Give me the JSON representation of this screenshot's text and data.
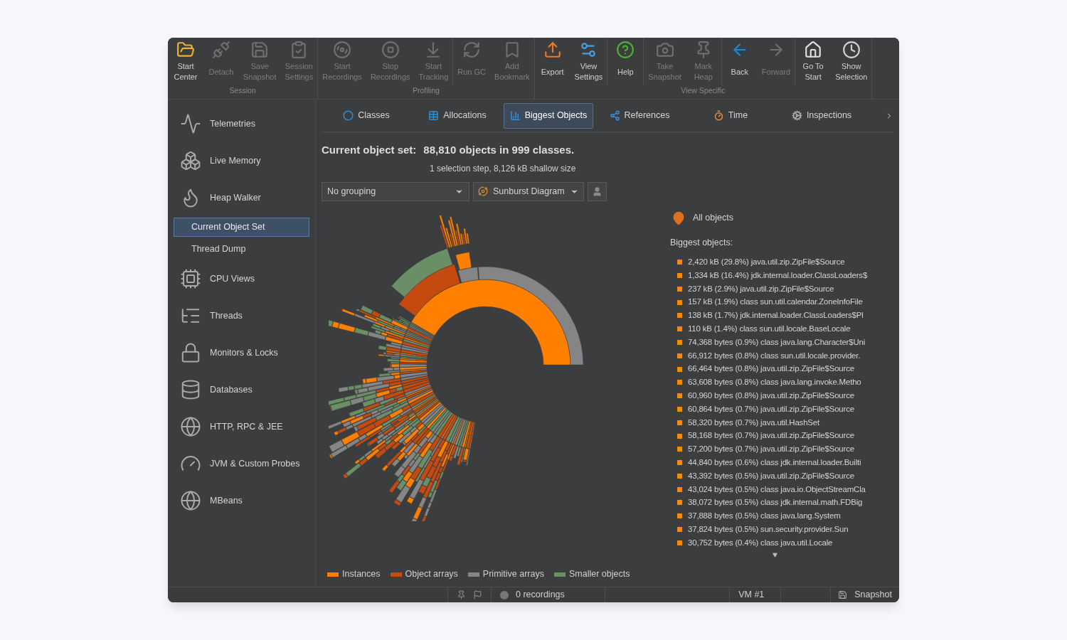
{
  "toolbar": {
    "groups": [
      {
        "label": "Session",
        "sections": [
          [
            {
              "label": "Start\nCenter",
              "disabled": false
            },
            {
              "label": "Detach",
              "disabled": true
            },
            {
              "label": "Save\nSnapshot",
              "disabled": true
            },
            {
              "label": "Session\nSettings",
              "disabled": true
            }
          ]
        ]
      },
      {
        "label": "Profiling",
        "sections": [
          [
            {
              "label": "Start\nRecordings",
              "disabled": true
            },
            {
              "label": "Stop\nRecordings",
              "disabled": true
            },
            {
              "label": "Start\nTracking",
              "disabled": true
            }
          ],
          [
            {
              "label": "Run GC",
              "disabled": true
            },
            {
              "label": "Add\nBookmark",
              "disabled": true
            }
          ]
        ]
      },
      {
        "label": "View Specific",
        "sections": [
          [
            {
              "label": "Export",
              "disabled": false
            },
            {
              "label": "View\nSettings",
              "disabled": false
            }
          ],
          [
            {
              "label": "Help",
              "disabled": false
            }
          ],
          [
            {
              "label": "Take\nSnapshot",
              "disabled": true
            },
            {
              "label": "Mark\nHeap",
              "disabled": true
            }
          ],
          [
            {
              "label": "Back",
              "disabled": false
            },
            {
              "label": "Forward",
              "disabled": true
            }
          ],
          [
            {
              "label": "Go To\nStart",
              "disabled": false
            },
            {
              "label": "Show\nSelection",
              "disabled": false
            }
          ]
        ]
      }
    ]
  },
  "sidebar": {
    "items": [
      {
        "kind": "view",
        "label": "Telemetries",
        "selected": false
      },
      {
        "kind": "view",
        "label": "Live Memory",
        "selected": false
      },
      {
        "kind": "view",
        "label": "Heap Walker",
        "selected": false
      },
      {
        "kind": "sub",
        "label": "Current Object Set",
        "selected": true
      },
      {
        "kind": "sub",
        "label": "Thread Dump",
        "selected": false
      },
      {
        "kind": "view",
        "label": "CPU Views",
        "selected": false
      },
      {
        "kind": "view",
        "label": "Threads",
        "selected": false
      },
      {
        "kind": "view",
        "label": "Monitors & Locks",
        "selected": false
      },
      {
        "kind": "view",
        "label": "Databases",
        "selected": false
      },
      {
        "kind": "view",
        "label": "HTTP, RPC & JEE",
        "selected": false
      },
      {
        "kind": "view",
        "label": "JVM & Custom Probes",
        "selected": false
      },
      {
        "kind": "view",
        "label": "MBeans",
        "selected": false
      }
    ]
  },
  "tabs": [
    {
      "label": "Classes",
      "selected": false
    },
    {
      "label": "Allocations",
      "selected": false
    },
    {
      "label": "Biggest Objects",
      "selected": true
    },
    {
      "label": "References",
      "selected": false
    },
    {
      "label": "Time",
      "selected": false
    },
    {
      "label": "Inspections",
      "selected": false
    }
  ],
  "header": {
    "title": "Current object set:",
    "summary": "88,810 objects in 999 classes.",
    "detail": "1 selection step, 8,126 kB shallow size"
  },
  "controls": {
    "grouping": "No grouping",
    "view": "Sunburst Diagram"
  },
  "details": {
    "root": "All objects",
    "heading": "Biggest objects:",
    "items": [
      "2,420 kB (29.8%) java.util.zip.ZipFile$Source",
      "1,334 kB (16.4%) jdk.internal.loader.ClassLoaders$",
      "237 kB (2.9%) java.util.zip.ZipFile$Source",
      "157 kB (1.9%) class sun.util.calendar.ZoneInfoFile",
      "138 kB (1.7%) jdk.internal.loader.ClassLoaders$Pl",
      "110 kB (1.4%) class sun.util.locale.BaseLocale",
      "74,368 bytes (0.9%) class java.lang.Character$Uni",
      "66,912 bytes (0.8%) class sun.util.locale.provider.",
      "66,464 bytes (0.8%) java.util.zip.ZipFile$Source",
      "63,608 bytes (0.8%) class java.lang.invoke.Metho",
      "60,960 bytes (0.8%) java.util.zip.ZipFile$Source",
      "60,864 bytes (0.7%) java.util.zip.ZipFile$Source",
      "58,320 bytes (0.7%) java.util.HashSet",
      "58,168 bytes (0.7%) java.util.zip.ZipFile$Source",
      "57,200 bytes (0.7%) java.util.zip.ZipFile$Source",
      "44,840 bytes (0.6%) class jdk.internal.loader.Builti",
      "43,392 bytes (0.5%) java.util.zip.ZipFile$Source",
      "43,024 bytes (0.5%) class java.io.ObjectStreamCla",
      "38,072 bytes (0.5%) class jdk.internal.math.FDBig",
      "37,888 bytes (0.5%) class java.lang.System",
      "37,824 bytes (0.5%) sun.security.provider.Sun",
      "30,752 bytes (0.4%) class java.util.Locale"
    ]
  },
  "legend": [
    {
      "label": "Instances",
      "color": "#ff8000"
    },
    {
      "label": "Object arrays",
      "color": "#c44a10"
    },
    {
      "label": "Primitive arrays",
      "color": "#858585"
    },
    {
      "label": "Smaller objects",
      "color": "#6a8f66"
    }
  ],
  "status_bar": {
    "recordings": "0 recordings",
    "vm": "VM #1",
    "mode": "Snapshot"
  }
}
